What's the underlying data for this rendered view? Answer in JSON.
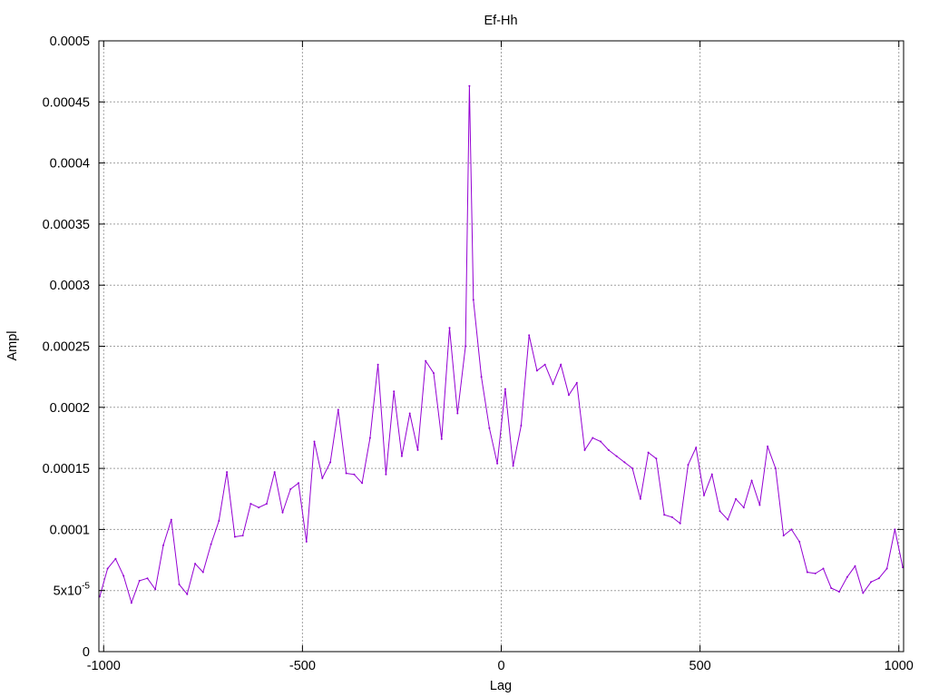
{
  "chart_data": {
    "type": "line",
    "title": "Ef-Hh",
    "xlabel": "Lag",
    "ylabel": "Ampl",
    "xlim": [
      -1012,
      1012
    ],
    "ylim": [
      0,
      0.0005
    ],
    "grid": true,
    "legend": "none",
    "series_color": "#9400d3",
    "axis_color": "#000000",
    "grid_color": "#a0a0a0",
    "x_ticks": [
      {
        "value": -1000,
        "label": "-1000"
      },
      {
        "value": -500,
        "label": "-500"
      },
      {
        "value": 0,
        "label": "0"
      },
      {
        "value": 500,
        "label": "500"
      },
      {
        "value": 1000,
        "label": "1000"
      }
    ],
    "y_ticks": [
      {
        "value": 0,
        "label": "0"
      },
      {
        "value": 5e-05,
        "label": "5x10",
        "sup": "-5"
      },
      {
        "value": 0.0001,
        "label": "0.0001"
      },
      {
        "value": 0.00015,
        "label": "0.00015"
      },
      {
        "value": 0.0002,
        "label": "0.0002"
      },
      {
        "value": 0.00025,
        "label": "0.00025"
      },
      {
        "value": 0.0003,
        "label": "0.0003"
      },
      {
        "value": 0.00035,
        "label": "0.00035"
      },
      {
        "value": 0.0004,
        "label": "0.0004"
      },
      {
        "value": 0.00045,
        "label": "0.00045"
      },
      {
        "value": 0.0005,
        "label": "0.0005"
      }
    ],
    "series": [
      {
        "x": [
          -1010,
          -990,
          -970,
          -950,
          -930,
          -910,
          -890,
          -870,
          -850,
          -830,
          -810,
          -790,
          -770,
          -750,
          -730,
          -710,
          -690,
          -670,
          -650,
          -630,
          -610,
          -590,
          -570,
          -550,
          -530,
          -510,
          -490,
          -470,
          -450,
          -430,
          -410,
          -390,
          -370,
          -350,
          -330,
          -310,
          -290,
          -270,
          -250,
          -230,
          -210,
          -190,
          -170,
          -150,
          -130,
          -110,
          -90,
          -80,
          -70,
          -50,
          -30,
          -10,
          10,
          30,
          50,
          70,
          90,
          110,
          130,
          150,
          170,
          190,
          210,
          230,
          250,
          270,
          290,
          310,
          330,
          350,
          370,
          390,
          410,
          430,
          450,
          470,
          490,
          510,
          530,
          550,
          570,
          590,
          610,
          630,
          650,
          670,
          690,
          710,
          730,
          750,
          770,
          790,
          810,
          830,
          850,
          870,
          890,
          910,
          930,
          950,
          970,
          990,
          1010
        ],
        "y": [
          4.5e-05,
          6.8e-05,
          7.6e-05,
          6.2e-05,
          4e-05,
          5.8e-05,
          6e-05,
          5.1e-05,
          8.7e-05,
          0.000108,
          5.5e-05,
          4.7e-05,
          7.2e-05,
          6.5e-05,
          8.8e-05,
          0.000107,
          0.000147,
          9.4e-05,
          9.5e-05,
          0.000121,
          0.000118,
          0.000121,
          0.000147,
          0.000114,
          0.000133,
          0.000138,
          9e-05,
          0.000172,
          0.000142,
          0.000155,
          0.000198,
          0.000146,
          0.000145,
          0.000138,
          0.000175,
          0.000235,
          0.000145,
          0.000213,
          0.00016,
          0.000195,
          0.000165,
          0.000238,
          0.000228,
          0.000174,
          0.000265,
          0.000195,
          0.00025,
          0.000463,
          0.000288,
          0.000225,
          0.000183,
          0.000154,
          0.000215,
          0.000152,
          0.000185,
          0.000259,
          0.00023,
          0.000235,
          0.000219,
          0.000235,
          0.00021,
          0.00022,
          0.000165,
          0.000175,
          0.000172,
          0.000165,
          0.00016,
          0.000155,
          0.00015,
          0.000125,
          0.000163,
          0.000158,
          0.000112,
          0.00011,
          0.000105,
          0.000153,
          0.000167,
          0.000128,
          0.000145,
          0.000115,
          0.000108,
          0.000125,
          0.000118,
          0.00014,
          0.00012,
          0.000168,
          0.00015,
          9.5e-05,
          0.0001,
          9e-05,
          6.5e-05,
          6.4e-05,
          6.8e-05,
          5.2e-05,
          4.9e-05,
          6.1e-05,
          7e-05,
          4.8e-05,
          5.7e-05,
          6e-05,
          6.8e-05,
          0.0001,
          6.9e-05
        ]
      }
    ]
  }
}
